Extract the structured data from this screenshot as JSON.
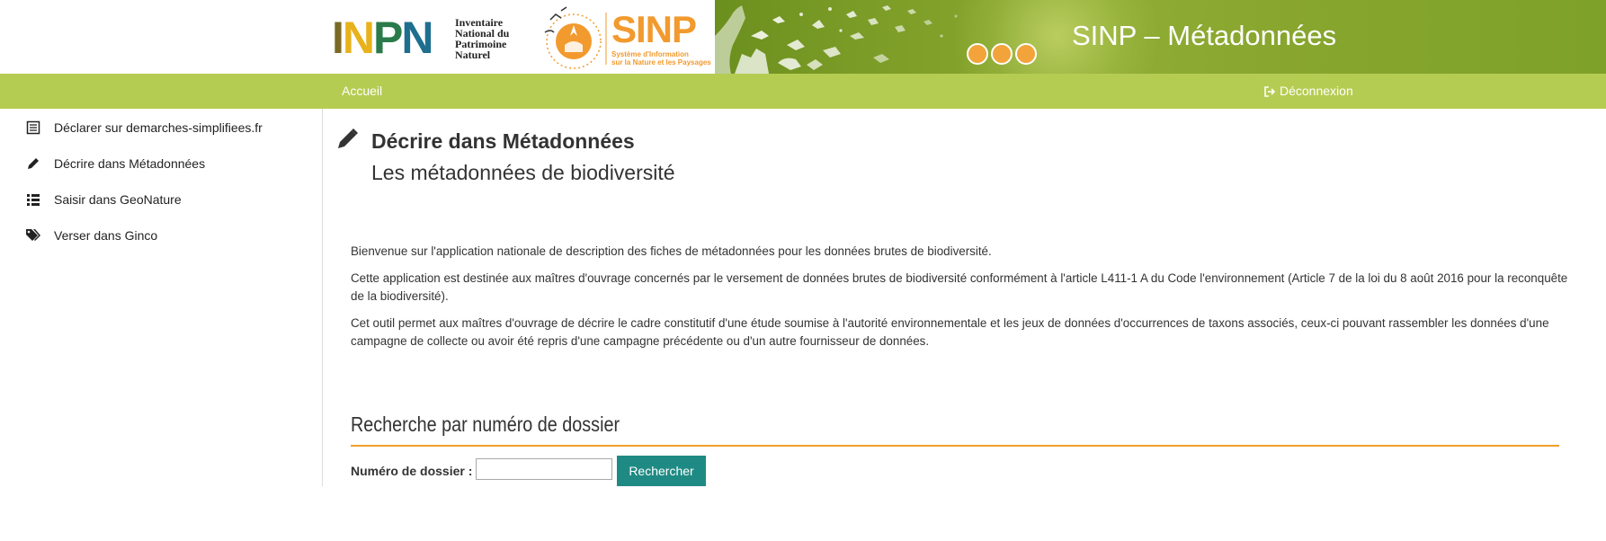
{
  "header": {
    "inpn": {
      "letters": [
        "I",
        "N",
        "P",
        "N"
      ],
      "text": "Inventaire\nNational du\nPatrimoine\nNaturel"
    },
    "sinp": {
      "word": "SINP",
      "subtitle": "Système d'Information\nsur la Nature et les Paysages"
    },
    "title": "SINP – Métadonnées"
  },
  "navbar": {
    "home": "Accueil",
    "logout": "Déconnexion"
  },
  "sidebar": {
    "items": [
      {
        "label": "Déclarer sur demarches-simplifiees.fr",
        "icon": "list-icon"
      },
      {
        "label": "Décrire dans Métadonnées",
        "icon": "pencil-icon"
      },
      {
        "label": "Saisir dans GeoNature",
        "icon": "bullet-list-icon"
      },
      {
        "label": "Verser dans Ginco",
        "icon": "tags-icon"
      }
    ]
  },
  "main": {
    "title": "Décrire dans Métadonnées",
    "subtitle": "Les métadonnées de biodiversité",
    "paragraphs": [
      "Bienvenue sur l'application nationale de description des fiches de métadonnées pour les données brutes de biodiversité.",
      "Cette application est destinée aux maîtres d'ouvrage concernés par le versement de données brutes de biodiversité conformément à l'article L411-1 A du Code l'environnement (Article 7 de la loi du 8 août 2016 pour la reconquête de la biodiversité).",
      "Cet outil permet aux maîtres d'ouvrage de décrire le cadre constitutif d'une étude soumise à l'autorité environnementale et les jeux de données d'occurrences de taxons associés, ceux-ci pouvant rassembler les données d'une campagne de collecte ou avoir été repris d'une campagne précédente ou d'un autre fournisseur de données."
    ],
    "search": {
      "section_title": "Recherche par numéro de dossier",
      "label": "Numéro de dossier :",
      "input_value": "",
      "button": "Rechercher"
    }
  },
  "colors": {
    "navbar": "#b5cc52",
    "banner": "#7a9b26",
    "accent_orange": "#f0a02a",
    "button_teal": "#1f8a84"
  }
}
